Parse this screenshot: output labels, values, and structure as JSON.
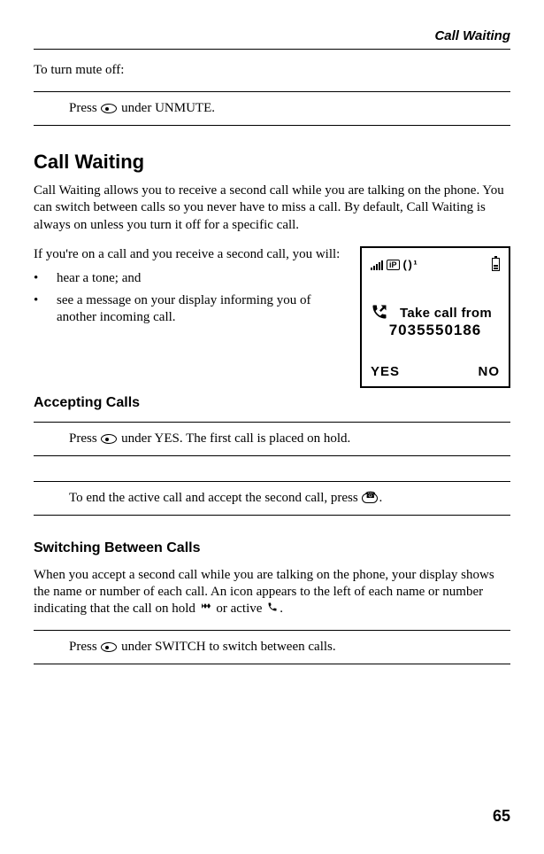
{
  "running_head": "Call Waiting",
  "intro_text": "To turn mute off:",
  "box1": "Press   under UNMUTE.",
  "box1_pre": "Press ",
  "box1_post": " under UNMUTE.",
  "section1_title": "Call Waiting",
  "section1_para": "Call Waiting allows you to receive a second call while you are talking on the phone. You can switch between calls so you never have to miss a call. By default, Call Waiting is always on unless you turn it off for a specific call.",
  "second_call_intro": "If you're on a call and you receive a second call, you will:",
  "bullets": [
    "hear a tone; and",
    "see a message on your display informing you of another incoming call."
  ],
  "phone_screen": {
    "take_line": "Take call from",
    "number": "7035550186",
    "softkey_left": "YES",
    "softkey_right": "NO"
  },
  "section2_title": "Accepting Calls",
  "box2_pre": "Press ",
  "box2_post": " under YES. The first call is placed on hold.",
  "box3_pre": "To end the active call and accept the second call, press ",
  "box3_post": ".",
  "section3_title": "Switching Between Calls",
  "section3_para_pre": "When you accept a second call while you are talking on the phone, your display shows the name or number of each call. An icon appears to the left of each name or number indicating that the call on hold ",
  "section3_para_mid": " or active ",
  "section3_para_post": ".",
  "box4_pre": "Press ",
  "box4_post": " under SWITCH to switch between calls.",
  "page_number": "65"
}
